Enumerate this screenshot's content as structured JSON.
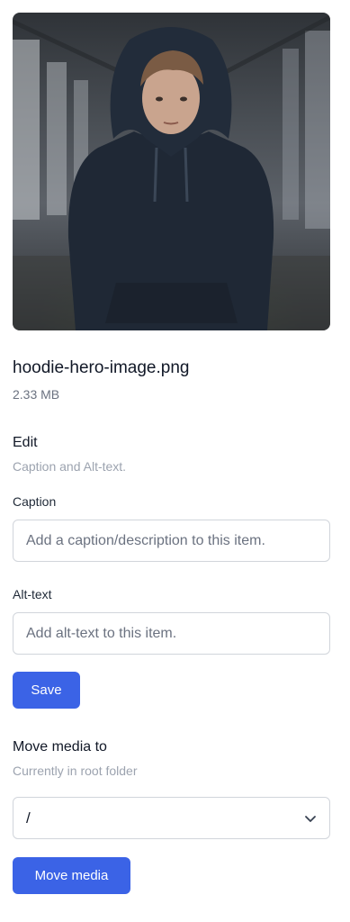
{
  "media": {
    "filename": "hoodie-hero-image.png",
    "size": "2.33 MB",
    "image_subject": "portrait-photo-hoodie"
  },
  "edit": {
    "title": "Edit",
    "subtitle": "Caption and Alt-text.",
    "caption_label": "Caption",
    "caption_value": "",
    "caption_placeholder": "Add a caption/description to this item.",
    "alt_label": "Alt-text",
    "alt_value": "",
    "alt_placeholder": "Add alt-text to this item.",
    "save_label": "Save"
  },
  "move": {
    "title": "Move media to",
    "subtitle": "Currently in root folder",
    "selected_folder": "/",
    "button_label": "Move media"
  },
  "colors": {
    "accent": "#3b63e6",
    "muted_text": "#9ca3af",
    "border": "#d1d5db"
  }
}
